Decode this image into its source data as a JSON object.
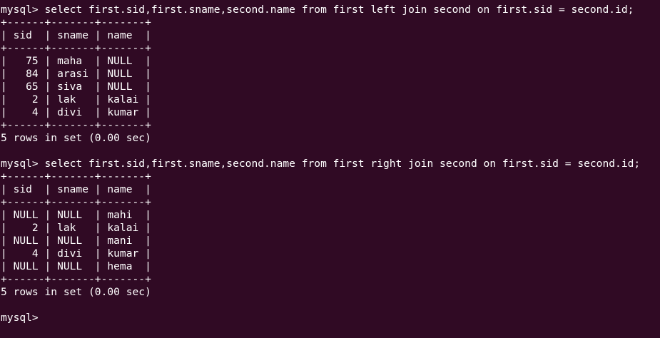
{
  "terminal": {
    "lines": [
      "+------+-------+-------+",
      "mysql> select first.sid,first.sname,second.name from first left join second on first.sid = second.id;",
      "+------+-------+-------+",
      "| sid  | sname | name  |",
      "+------+-------+-------+",
      "|   75 | maha  | NULL  |",
      "|   84 | arasi | NULL  |",
      "|   65 | siva  | NULL  |",
      "|    2 | lak   | kalai |",
      "|    4 | divi  | kumar |",
      "+------+-------+-------+",
      "5 rows in set (0.00 sec)",
      "",
      "mysql> select first.sid,first.sname,second.name from first right join second on first.sid = second.id;",
      "+------+-------+-------+",
      "| sid  | sname | name  |",
      "+------+-------+-------+",
      "| NULL | NULL  | mahi  |",
      "|    2 | lak   | kalai |",
      "| NULL | NULL  | mani  |",
      "|    4 | divi  | kumar |",
      "| NULL | NULL  | hema  |",
      "+------+-------+-------+",
      "5 rows in set (0.00 sec)",
      "",
      "mysql> "
    ]
  }
}
